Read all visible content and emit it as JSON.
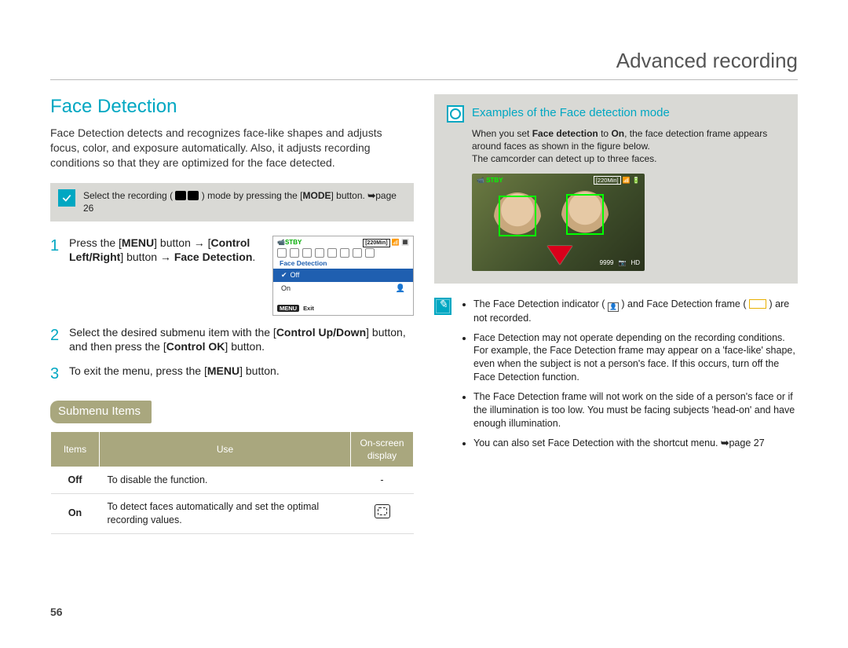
{
  "header": {
    "title": "Advanced recording"
  },
  "left": {
    "section_title": "Face Detection",
    "intro": "Face Detection detects and recognizes face-like shapes and adjusts focus, color, and exposure automatically. Also, it adjusts recording conditions so that they are optimized for the face detected.",
    "note_prefix": "Select the recording (",
    "note_suffix": ") mode by pressing the [",
    "note_mode": "MODE",
    "note_tail": "] button. ",
    "note_ref": "page 26",
    "steps": [
      {
        "num": "1",
        "parts": {
          "a": "Press the [",
          "menu": "MENU",
          "b": "] button → [",
          "ctrl_lr": "Control Left/Right",
          "c": "] button → ",
          "face_det": "Face Detection",
          "d": "."
        }
      },
      {
        "num": "2",
        "parts": {
          "a": "Select the desired submenu item with the [",
          "ctrl_ud": "Control Up/Down",
          "b": "] button, and then press the [",
          "ctrl_ok": "Control OK",
          "c": "] button."
        }
      },
      {
        "num": "3",
        "parts": {
          "a": "To exit the menu, press the [",
          "menu": "MENU",
          "b": "] button."
        }
      }
    ],
    "lcd": {
      "stby": "STBY",
      "time": "[220Min]",
      "menu_name": "Face Detection",
      "off": "Off",
      "on": "On",
      "exit_btn": "MENU",
      "exit": " Exit"
    },
    "submenu_title": "Submenu Items",
    "table": {
      "headers": {
        "items": "Items",
        "use": "Use",
        "display": "On-screen display"
      },
      "rows": [
        {
          "item": "Off",
          "use": "To disable the function.",
          "display": "-"
        },
        {
          "item": "On",
          "use": "To detect faces automatically and set the optimal recording values.",
          "display": "face-detection-indicator"
        }
      ]
    }
  },
  "right": {
    "example_title": "Examples of the Face detection mode",
    "example_text_a": "When you set ",
    "example_text_b": "Face detection",
    "example_text_c": " to ",
    "example_text_d": "On",
    "example_text_e": ", the face detection frame appears around faces as shown in the figure below.",
    "example_text_f": "The camcorder can detect up to three faces.",
    "photo": {
      "stby": "STBY",
      "time": "[220Min]",
      "count": "9999",
      "quality": "HD"
    },
    "notes": [
      {
        "a": "The Face Detection indicator (",
        "b": ") and Face Detection frame (",
        "c": ") are not recorded."
      },
      {
        "text": "Face Detection may not operate depending on the recording conditions. For example, the Face Detection frame may appear on a 'face-like' shape, even when the subject is not a person's face. If this occurs, turn off the Face Detection function."
      },
      {
        "text": "The Face Detection frame will not work on the side of a person's face or if the illumination is too low. You must be facing subjects 'head-on' and have enough illumination."
      },
      {
        "a": "You can also set Face Detection with the shortcut menu. ",
        "ref": "page 27"
      }
    ]
  },
  "page_number": "56"
}
